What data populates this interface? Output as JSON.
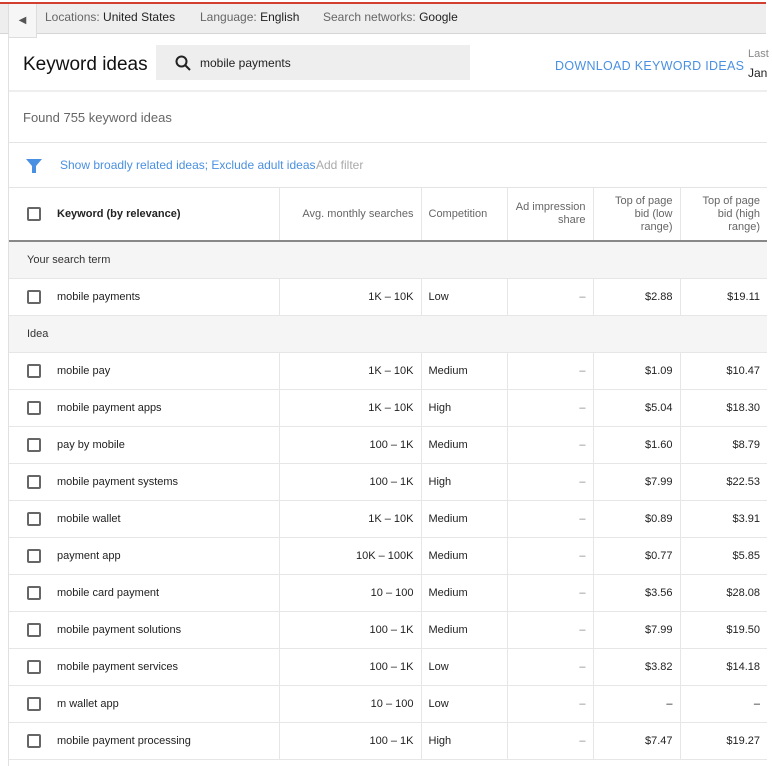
{
  "topbar": {
    "locations_label": "Locations:",
    "locations": "United States",
    "language_label": "Language:",
    "language": "English",
    "networks_label": "Search networks:",
    "networks": "Google"
  },
  "header": {
    "title": "Keyword ideas",
    "search_value": "mobile payments",
    "download": "DOWNLOAD KEYWORD IDEAS",
    "last_label": "Last",
    "date_partial": "Jan"
  },
  "found": "Found 755 keyword ideas",
  "filter": {
    "text": "Show broadly related ideas; Exclude adult ideas",
    "add": "Add filter",
    "accent": "#4a90e2"
  },
  "columns": [
    "Keyword (by relevance)",
    "Avg. monthly searches",
    "Competition",
    "Ad impression share",
    "Top of page bid (low range)",
    "Top of page bid (high range)"
  ],
  "sections": {
    "search_term": "Your search term",
    "idea": "Idea"
  },
  "search_term_row": [
    "mobile payments",
    "1K – 10K",
    "Low",
    "–",
    "$2.88",
    "$19.11"
  ],
  "rows": [
    [
      "mobile pay",
      "1K – 10K",
      "Medium",
      "–",
      "$1.09",
      "$10.47"
    ],
    [
      "mobile payment apps",
      "1K – 10K",
      "High",
      "–",
      "$5.04",
      "$18.30"
    ],
    [
      "pay by mobile",
      "100 – 1K",
      "Medium",
      "–",
      "$1.60",
      "$8.79"
    ],
    [
      "mobile payment systems",
      "100 – 1K",
      "High",
      "–",
      "$7.99",
      "$22.53"
    ],
    [
      "mobile wallet",
      "1K – 10K",
      "Medium",
      "–",
      "$0.89",
      "$3.91"
    ],
    [
      "payment app",
      "10K – 100K",
      "Medium",
      "–",
      "$0.77",
      "$5.85"
    ],
    [
      "mobile card payment",
      "10 – 100",
      "Medium",
      "–",
      "$3.56",
      "$28.08"
    ],
    [
      "mobile payment solutions",
      "100 – 1K",
      "Medium",
      "–",
      "$7.99",
      "$19.50"
    ],
    [
      "mobile payment services",
      "100 – 1K",
      "Low",
      "–",
      "$3.82",
      "$14.18"
    ],
    [
      "m wallet app",
      "10 – 100",
      "Low",
      "–",
      "–",
      "–"
    ],
    [
      "mobile payment processing",
      "100 – 1K",
      "High",
      "–",
      "$7.47",
      "$19.27"
    ]
  ]
}
